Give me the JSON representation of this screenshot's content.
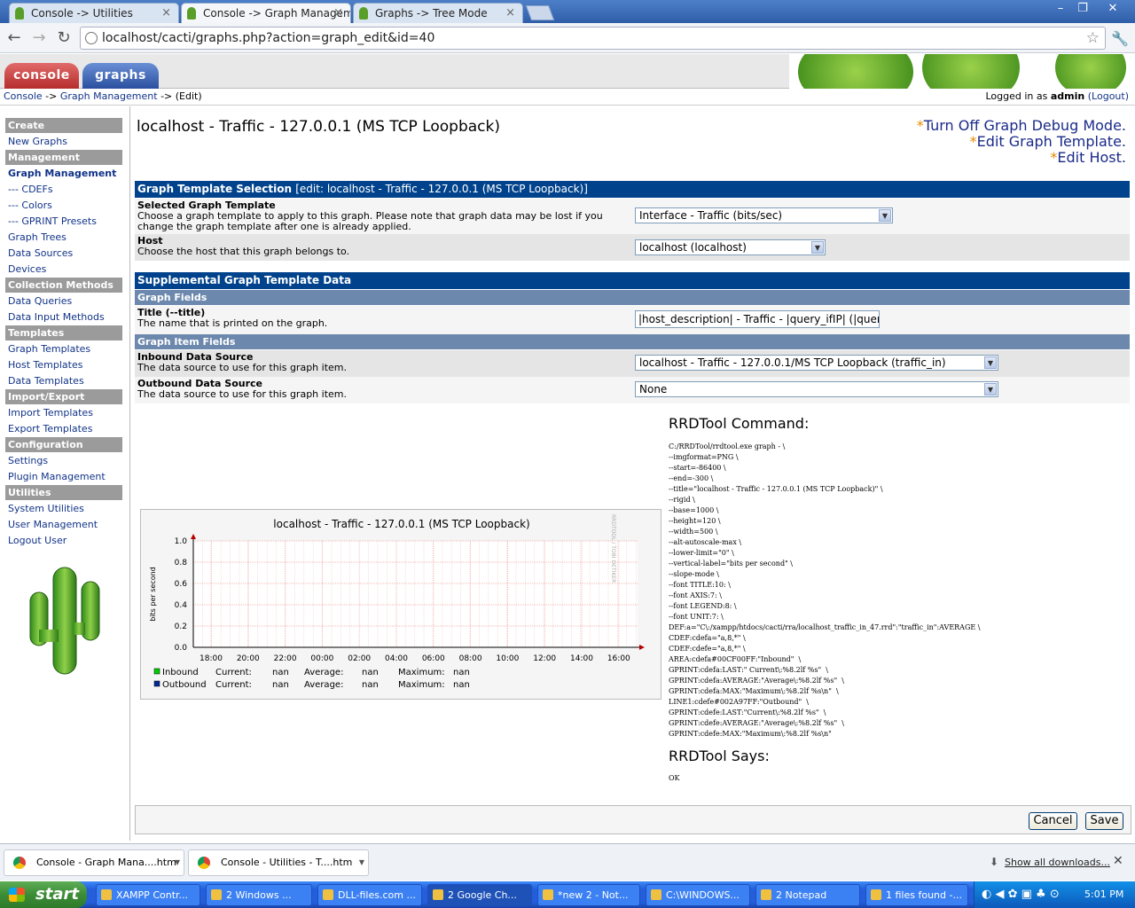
{
  "browser": {
    "tabs": [
      {
        "title": "Console -> Utilities"
      },
      {
        "title": "Console -> Graph Managemen"
      },
      {
        "title": "Graphs -> Tree Mode"
      }
    ],
    "url": "localhost/cacti/graphs.php?action=graph_edit&id=40"
  },
  "cacti": {
    "tabs": {
      "console": "console",
      "graphs": "graphs"
    },
    "breadcrumb": {
      "console": "Console",
      "sep1": "->",
      "graph_mgmt": "Graph Management",
      "sep2": "->",
      "edit": "(Edit)"
    },
    "login": {
      "prefix": "Logged in as",
      "user": "admin",
      "logout": "(Logout)"
    }
  },
  "sidebar": [
    {
      "label": "Create",
      "type": "head"
    },
    {
      "label": "New Graphs",
      "type": "link"
    },
    {
      "label": "Management",
      "type": "head"
    },
    {
      "label": "Graph Management",
      "type": "link",
      "selected": true
    },
    {
      "label": "--- CDEFs",
      "type": "link"
    },
    {
      "label": "--- Colors",
      "type": "link"
    },
    {
      "label": "--- GPRINT Presets",
      "type": "link"
    },
    {
      "label": "Graph Trees",
      "type": "link"
    },
    {
      "label": "Data Sources",
      "type": "link"
    },
    {
      "label": "Devices",
      "type": "link"
    },
    {
      "label": "Collection Methods",
      "type": "head"
    },
    {
      "label": "Data Queries",
      "type": "link"
    },
    {
      "label": "Data Input Methods",
      "type": "link"
    },
    {
      "label": "Templates",
      "type": "head"
    },
    {
      "label": "Graph Templates",
      "type": "link"
    },
    {
      "label": "Host Templates",
      "type": "link"
    },
    {
      "label": "Data Templates",
      "type": "link"
    },
    {
      "label": "Import/Export",
      "type": "head"
    },
    {
      "label": "Import Templates",
      "type": "link"
    },
    {
      "label": "Export Templates",
      "type": "link"
    },
    {
      "label": "Configuration",
      "type": "head"
    },
    {
      "label": "Settings",
      "type": "link"
    },
    {
      "label": "Plugin Management",
      "type": "link"
    },
    {
      "label": "Utilities",
      "type": "head"
    },
    {
      "label": "System Utilities",
      "type": "link"
    },
    {
      "label": "User Management",
      "type": "link"
    },
    {
      "label": "Logout User",
      "type": "link"
    }
  ],
  "main": {
    "title": "localhost - Traffic - 127.0.0.1 (MS TCP Loopback)",
    "links": {
      "debug": "Turn Off Graph Debug Mode.",
      "edit_template": "Edit Graph Template.",
      "edit_host": "Edit Host."
    },
    "section1": {
      "title": "Graph Template Selection",
      "sub": "[edit: localhost - Traffic - 127.0.0.1 (MS TCP Loopback)]"
    },
    "template": {
      "label": "Selected Graph Template",
      "desc": "Choose a graph template to apply to this graph. Please note that graph data may be lost if you change the graph template after one is already applied.",
      "value": "Interface - Traffic (bits/sec)"
    },
    "host": {
      "label": "Host",
      "desc": "Choose the host that this graph belongs to.",
      "value": "localhost (localhost)"
    },
    "section2": {
      "title": "Supplemental Graph Template Data"
    },
    "graph_fields": "Graph Fields",
    "title_field": {
      "label": "Title (--title)",
      "desc": "The name that is printed on the graph.",
      "value": "|host_description| - Traffic - |query_ifIP| (|query_"
    },
    "graph_item_fields": "Graph Item Fields",
    "inbound": {
      "label": "Inbound Data Source",
      "desc": "The data source to use for this graph item.",
      "value": "localhost - Traffic - 127.0.0.1/MS TCP Loopback (traffic_in)"
    },
    "outbound": {
      "label": "Outbound Data Source",
      "desc": "The data source to use for this graph item.",
      "value": "None"
    },
    "rrd_command_title": "RRDTool Command:",
    "rrd_command": "C:/RRDTool/rrdtool.exe graph - \\\n--imgformat=PNG \\\n--start=-86400 \\\n--end=-300 \\\n--title=\"localhost - Traffic - 127.0.0.1 (MS TCP Loopback)\" \\\n--rigid \\\n--base=1000 \\\n--height=120 \\\n--width=500 \\\n--alt-autoscale-max \\\n--lower-limit=\"0\" \\\n--vertical-label=\"bits per second\" \\\n--slope-mode \\\n--font TITLE:10: \\\n--font AXIS:7: \\\n--font LEGEND:8: \\\n--font UNIT:7: \\\nDEF:a=\"C\\:/xampp/htdocs/cacti/rra/localhost_traffic_in_47.rrd\":\"traffic_in\":AVERAGE \\\nCDEF:cdefa=\"a,8,*\" \\\nCDEF:cdefe=\"a,8,*\" \\\nAREA:cdefa#00CF00FF:\"Inbound\"  \\\nGPRINT:cdefa:LAST:\" Current\\:%8.2lf %s\"  \\\nGPRINT:cdefa:AVERAGE:\"Average\\:%8.2lf %s\"  \\\nGPRINT:cdefa:MAX:\"Maximum\\:%8.2lf %s\\n\"  \\\nLINE1:cdefe#002A97FF:\"Outbound\"  \\\nGPRINT:cdefe:LAST:\"Current\\:%8.2lf %s\"  \\\nGPRINT:cdefe:AVERAGE:\"Average\\:%8.2lf %s\"  \\\nGPRINT:cdefe:MAX:\"Maximum\\:%8.2lf %s\\n\"",
    "rrd_says_title": "RRDTool Says:",
    "rrd_says": "OK",
    "buttons": {
      "cancel": "Cancel",
      "save": "Save"
    }
  },
  "chart_data": {
    "type": "line",
    "title": "localhost - Traffic - 127.0.0.1 (MS TCP Loopback)",
    "ylabel": "bits per second",
    "watermark": "RRDTOOL / TOBI OETIKER",
    "ylim": [
      0,
      1.0
    ],
    "yticks": [
      "0.0",
      "0.2",
      "0.4",
      "0.6",
      "0.8",
      "1.0"
    ],
    "xticks": [
      "18:00",
      "20:00",
      "22:00",
      "00:00",
      "02:00",
      "04:00",
      "06:00",
      "08:00",
      "10:00",
      "12:00",
      "14:00",
      "16:00"
    ],
    "series": [
      {
        "name": "Inbound",
        "color": "#00CF00",
        "values": []
      },
      {
        "name": "Outbound",
        "color": "#002A97",
        "values": []
      }
    ],
    "legend": [
      {
        "name": "Inbound",
        "current_label": "Current:",
        "current": "nan",
        "average_label": "Average:",
        "average": "nan",
        "maximum_label": "Maximum:",
        "maximum": "nan"
      },
      {
        "name": "Outbound",
        "current_label": "Current:",
        "current": "nan",
        "average_label": "Average:",
        "average": "nan",
        "maximum_label": "Maximum:",
        "maximum": "nan"
      }
    ]
  },
  "downloads": {
    "items": [
      "Console - Graph Mana....htm",
      "Console - Utilities - T....htm"
    ],
    "show_all": "Show all downloads..."
  },
  "taskbar": {
    "start": "start",
    "items": [
      "XAMPP Contr...",
      "2 Windows ...",
      "DLL-files.com ...",
      "2 Google Ch...",
      "*new 2 - Not...",
      "C:\\WINDOWS...",
      "2 Notepad",
      "1 files found -..."
    ],
    "clock": "5:01 PM"
  }
}
